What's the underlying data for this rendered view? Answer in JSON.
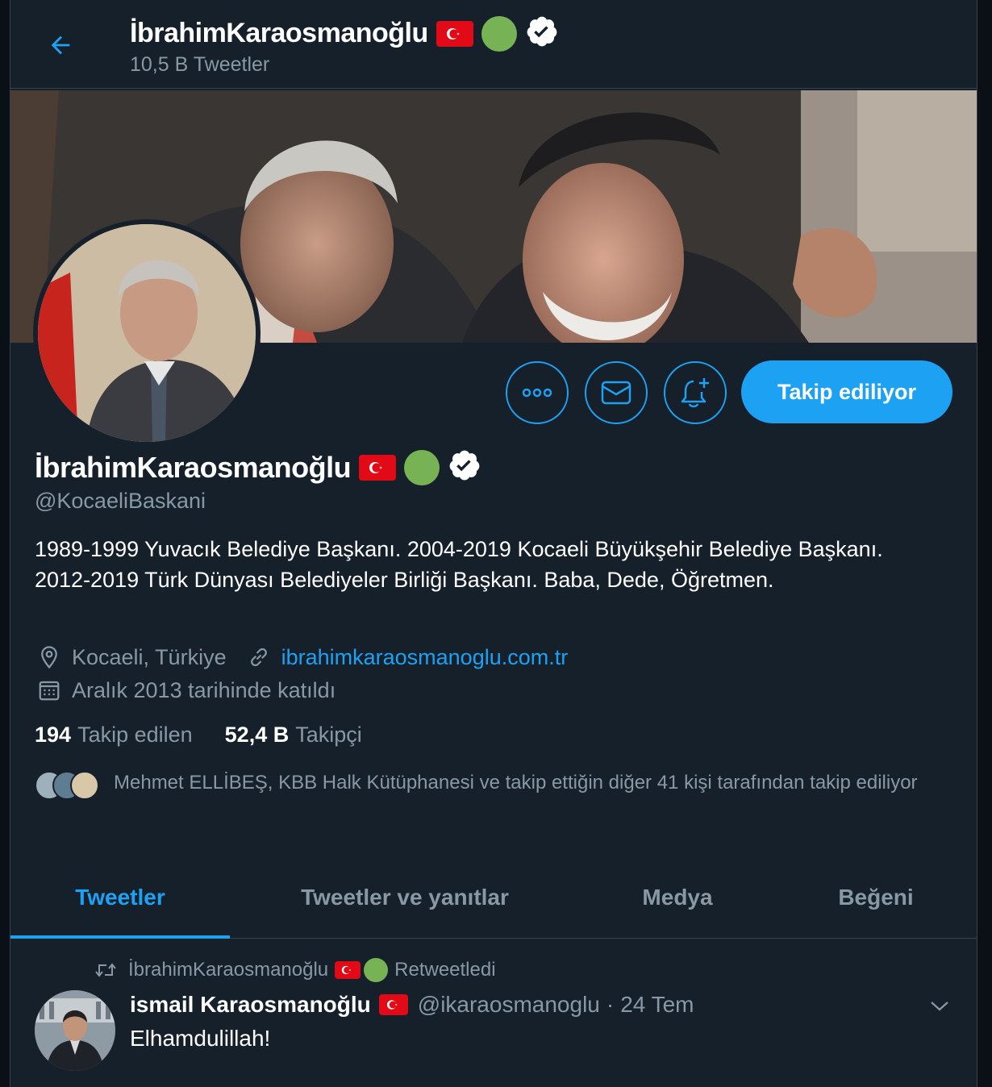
{
  "header": {
    "name": "İbrahimKaraosmanoğlu",
    "tweet_count": "10,5 B Tweetler"
  },
  "profile": {
    "name": "İbrahimKaraosmanoğlu",
    "handle": "@KocaeliBaskani",
    "bio": "1989-1999 Yuvacık Belediye Başkanı. 2004-2019 Kocaeli Büyükşehir Belediye Başkanı. 2012-2019 Türk Dünyası Belediyeler Birliği Başkanı. Baba, Dede, Öğretmen.",
    "location": "Kocaeli, Türkiye",
    "website": "ibrahimkaraosmanoglu.com.tr",
    "joined": "Aralık 2013 tarihinde katıldı",
    "following_count": "194",
    "following_label": "Takip edilen",
    "followers_count": "52,4 B",
    "followers_label": "Takipçi",
    "followed_by": "Mehmet ELLİBEŞ, KBB Halk Kütüphanesi ve takip ettiğin diğer 41 kişi tarafından takip ediliyor"
  },
  "actions": {
    "follow_label": "Takip ediliyor"
  },
  "tabs": [
    {
      "label": "Tweetler",
      "active": true
    },
    {
      "label": "Tweetler ve yanıtlar",
      "active": false
    },
    {
      "label": "Medya",
      "active": false
    },
    {
      "label": "Beğeni",
      "active": false
    }
  ],
  "tweet": {
    "retweeter": "İbrahimKaraosmanoğlu",
    "retweet_label": "Retweetledi",
    "author_name": "ismail Karaosmanoğlu",
    "author_handle": "@ikaraosmanoglu",
    "separator": "·",
    "date": "24 Tem",
    "text": "Elhamdulillah!"
  },
  "colors": {
    "background": "#15202b",
    "accent": "#1da1f2",
    "secondary_text": "#8899a6",
    "flag_red": "#e30a17",
    "green_circle": "#77b255"
  },
  "icons": [
    "back-arrow-icon",
    "turkish-flag-icon",
    "green-circle-icon",
    "verified-badge-icon",
    "more-icon",
    "mail-icon",
    "notification-bell-icon",
    "location-icon",
    "link-icon",
    "calendar-icon",
    "retweet-icon",
    "chevron-down-icon"
  ]
}
